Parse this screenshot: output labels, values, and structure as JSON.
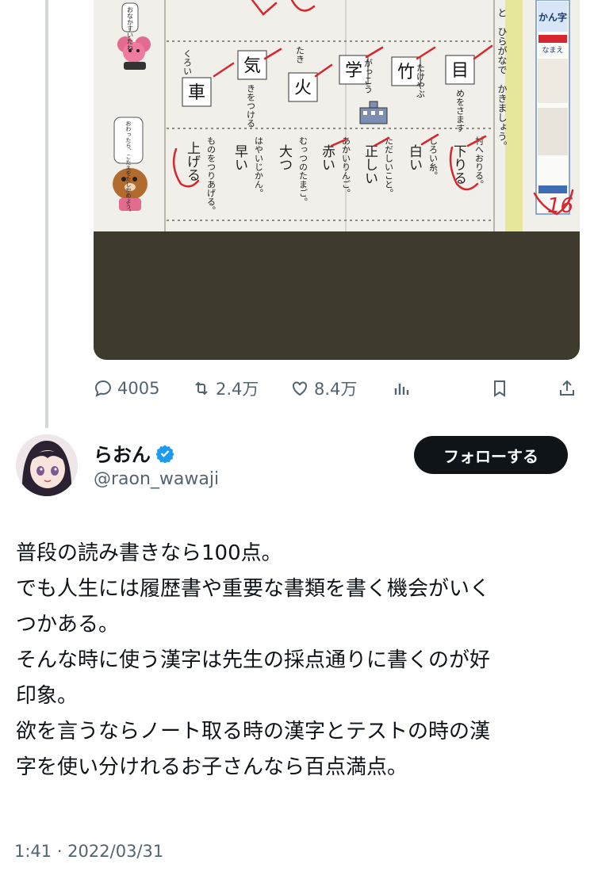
{
  "image_text": {
    "left_bubble_top": "おなかすいたね",
    "left_bubble_bottom": "おわったら、こたえをたしかめよう。",
    "right_header": "かん字",
    "name_label": "なまえ",
    "score": "16",
    "top_row_kana": "と　ひらがなで　かきましょう。",
    "kanji_boxes": [
      "車",
      "気",
      "火",
      "学",
      "竹",
      "目"
    ],
    "kana_pieces": [
      "くろい",
      "きをつける",
      "たき",
      "がっこう",
      "たけやぶ",
      "めをさます"
    ],
    "answers": [
      "上げる",
      "早い",
      "大つ",
      "赤い",
      "正しい",
      "白い",
      "下りる"
    ],
    "sentences": [
      "ものをつりあげる。",
      "はやいじかん。",
      "むっつのたまご。",
      "あかいりんご。",
      "ただしいこと。",
      "しろい糸。",
      "村へおりる。"
    ]
  },
  "actions": {
    "reply": "4005",
    "retweet": "2.4万",
    "like": "8.4万"
  },
  "account": {
    "display_name": "らおん",
    "handle": "@raon_wawaji",
    "follow_label": "フォローする"
  },
  "tweet": {
    "lines": [
      "普段の読み書きなら100点。",
      "でも人生には履歴書や重要な書類を書く機会がいく",
      "つかある。",
      "そんな時に使う漢字は先生の採点通りに書くのが好",
      "印象。",
      "欲を言うならノート取る時の漢字とテストの時の漢",
      "字を使い分けれるお子さんなら百点満点。"
    ],
    "timestamp": "1:41 · 2022/03/31"
  },
  "colors": {
    "verified": "#1d9bf0",
    "muted": "#536471",
    "follow_bg": "#0f1419",
    "red_ink": "#d8262e",
    "dark_panel": "#3e3b2e"
  }
}
